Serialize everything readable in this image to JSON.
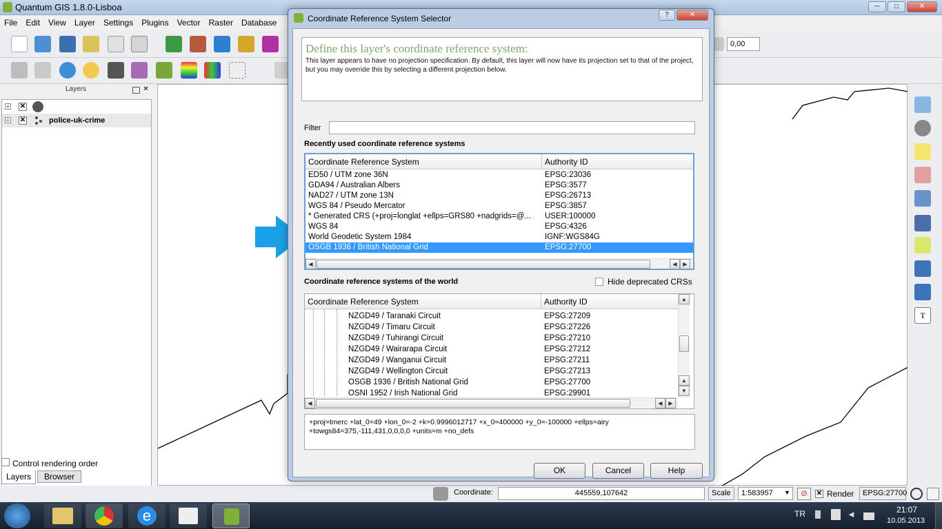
{
  "app": {
    "title": "Quantum GIS 1.8.0-Lisboa",
    "window_buttons": [
      "─",
      "□",
      "✕"
    ]
  },
  "menu": [
    "File",
    "Edit",
    "View",
    "Layer",
    "Settings",
    "Plugins",
    "Vector",
    "Raster",
    "Database"
  ],
  "toolbar": {
    "rotation_value": "0,00"
  },
  "layers_panel": {
    "title": "Layers",
    "items": [
      {
        "name": ""
      },
      {
        "name": "police-uk-crime"
      }
    ],
    "control_rendering_label": "Control rendering order",
    "tabs": [
      "Layers",
      "Browser"
    ]
  },
  "status_bar": {
    "coordinate_label": "Coordinate:",
    "coordinate_value": "445559,107642",
    "scale_label": "Scale",
    "scale_value": "1:583957",
    "render_label": "Render",
    "crs": "EPSG:27700"
  },
  "taskbar": {
    "language": "TR",
    "time": "21:07",
    "date": "10.05.2013"
  },
  "dialog": {
    "title": "Coordinate Reference System Selector",
    "help_button": "?",
    "close_button": "✕",
    "hint_title": "Define this layer's coordinate reference system:",
    "hint_text": "This layer appears to have no projection specification. By default, this layer will now have its projection set to that of the project, but you may override this by selecting a different projection below.",
    "filter_label": "Filter",
    "filter_value": "",
    "recent_label": "Recently used coordinate reference systems",
    "col_crs": "Coordinate Reference System",
    "col_authority": "Authority ID",
    "recent": [
      {
        "crs": "ED50 / UTM zone 36N",
        "id": "EPSG:23036"
      },
      {
        "crs": "GDA94 / Australian Albers",
        "id": "EPSG:3577"
      },
      {
        "crs": "NAD27 / UTM zone 13N",
        "id": "EPSG:26713"
      },
      {
        "crs": "WGS 84 / Pseudo Mercator",
        "id": "EPSG:3857"
      },
      {
        "crs": " * Generated CRS (+proj=longlat +ellps=GRS80 +nadgrids=@...",
        "id": "USER:100000"
      },
      {
        "crs": "WGS 84",
        "id": "EPSG:4326"
      },
      {
        "crs": "World Geodetic System 1984",
        "id": "IGNF:WGS84G"
      },
      {
        "crs": "OSGB 1936 / British National Grid",
        "id": "EPSG:27700",
        "selected": true
      }
    ],
    "world_label": "Coordinate reference systems of the world",
    "hide_deprecated": "Hide deprecated CRSs",
    "world": [
      {
        "crs": "NZGD49 / Taranaki Circuit",
        "id": "EPSG:27209"
      },
      {
        "crs": "NZGD49 / Timaru Circuit",
        "id": "EPSG:27226"
      },
      {
        "crs": "NZGD49 / Tuhirangi Circuit",
        "id": "EPSG:27210"
      },
      {
        "crs": "NZGD49 / Wairarapa Circuit",
        "id": "EPSG:27212"
      },
      {
        "crs": "NZGD49 / Wanganui Circuit",
        "id": "EPSG:27211"
      },
      {
        "crs": "NZGD49 / Wellington Circuit",
        "id": "EPSG:27213"
      },
      {
        "crs": "OSGB 1936 / British National Grid",
        "id": "EPSG:27700"
      },
      {
        "crs": "OSNI 1952 / Irish National Grid",
        "id": "EPSG:29901"
      }
    ],
    "proj_string": "+proj=tmerc +lat_0=49 +lon_0=-2 +k=0.9996012717 +x_0=400000 +y_0=-100000 +ellps=airy +towgs84=375,-111,431,0,0,0,0 +units=m +no_defs",
    "ok": "OK",
    "cancel": "Cancel",
    "help": "Help"
  },
  "colors": {
    "selection": "#3399ff",
    "arrow": "#1aa0e6",
    "hint_title": "#7ea86a"
  }
}
